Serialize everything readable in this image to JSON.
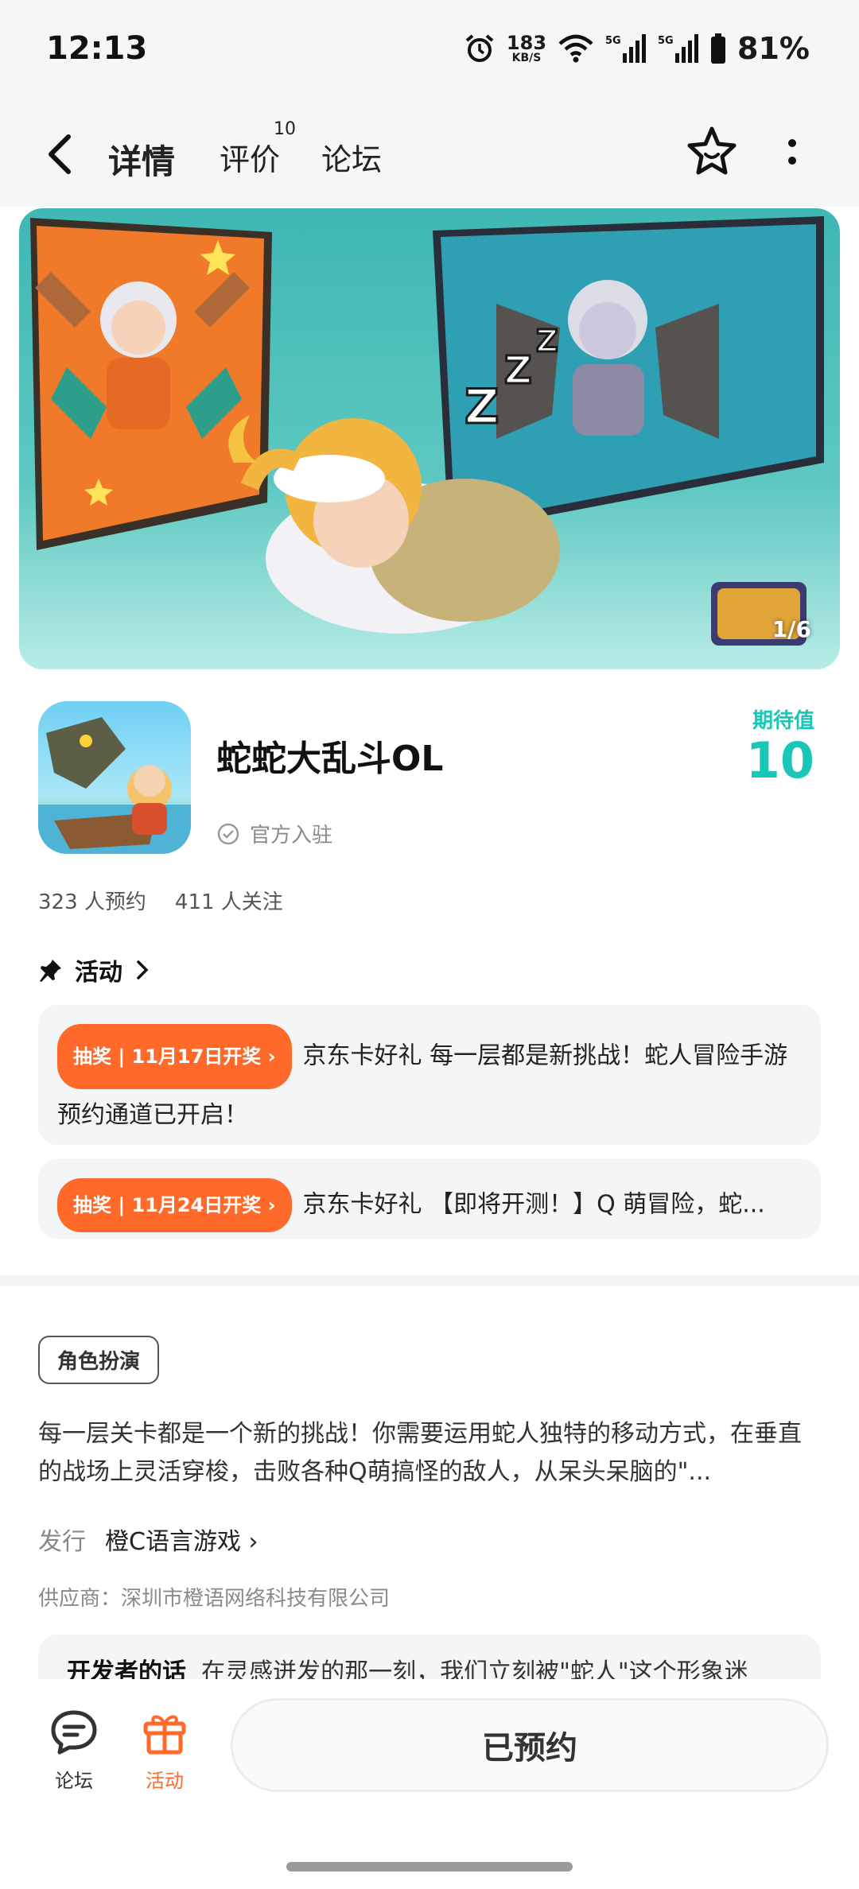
{
  "status_bar": {
    "time": "12:13",
    "net_speed": "183",
    "net_unit": "KB/S",
    "signal1": "5G",
    "signal2": "5G",
    "battery": "81%"
  },
  "header": {
    "tabs": [
      {
        "label": "详情",
        "active": true
      },
      {
        "label": "评价",
        "badge": "10"
      },
      {
        "label": "论坛"
      }
    ]
  },
  "banner": {
    "counter": "1/6"
  },
  "game": {
    "title": "蛇蛇大乱斗OL",
    "official_label": "官方入驻",
    "expect_label": "期待值",
    "expect_value": "10",
    "reservations": "323 人预约",
    "followers": "411 人关注"
  },
  "activity": {
    "title": "活动",
    "items": [
      {
        "tag": "抽奖 | 11月17日开奖 ›",
        "text": "京东卡好礼 每一层都是新挑战！蛇人冒险手游预约通道已开启！"
      },
      {
        "tag": "抽奖 | 11月24日开奖 ›",
        "text": "京东卡好礼 【即将开测！】Q 萌冒险，蛇..."
      }
    ]
  },
  "details": {
    "genre_tag": "角色扮演",
    "description": "每一层关卡都是一个新的挑战！你需要运用蛇人独特的移动方式，在垂直的战场上灵活穿梭，击败各种Q萌搞怪的敌人，从呆头呆脑的\"...",
    "publisher_label": "发行",
    "publisher_value": "橙C语言游戏 ›",
    "supplier": "供应商：深圳市橙语网络科技有限公司",
    "dev_words_label": "开发者的话",
    "dev_words_text": "在灵感迸发的那一刻，我们立刻被\"蛇人\"这个形象迷"
  },
  "bottom_bar": {
    "forum_label": "论坛",
    "activity_label": "活动",
    "reserved_button": "已预约"
  },
  "colors": {
    "accent": "#19c7b9",
    "orange": "#ff6a2a"
  }
}
